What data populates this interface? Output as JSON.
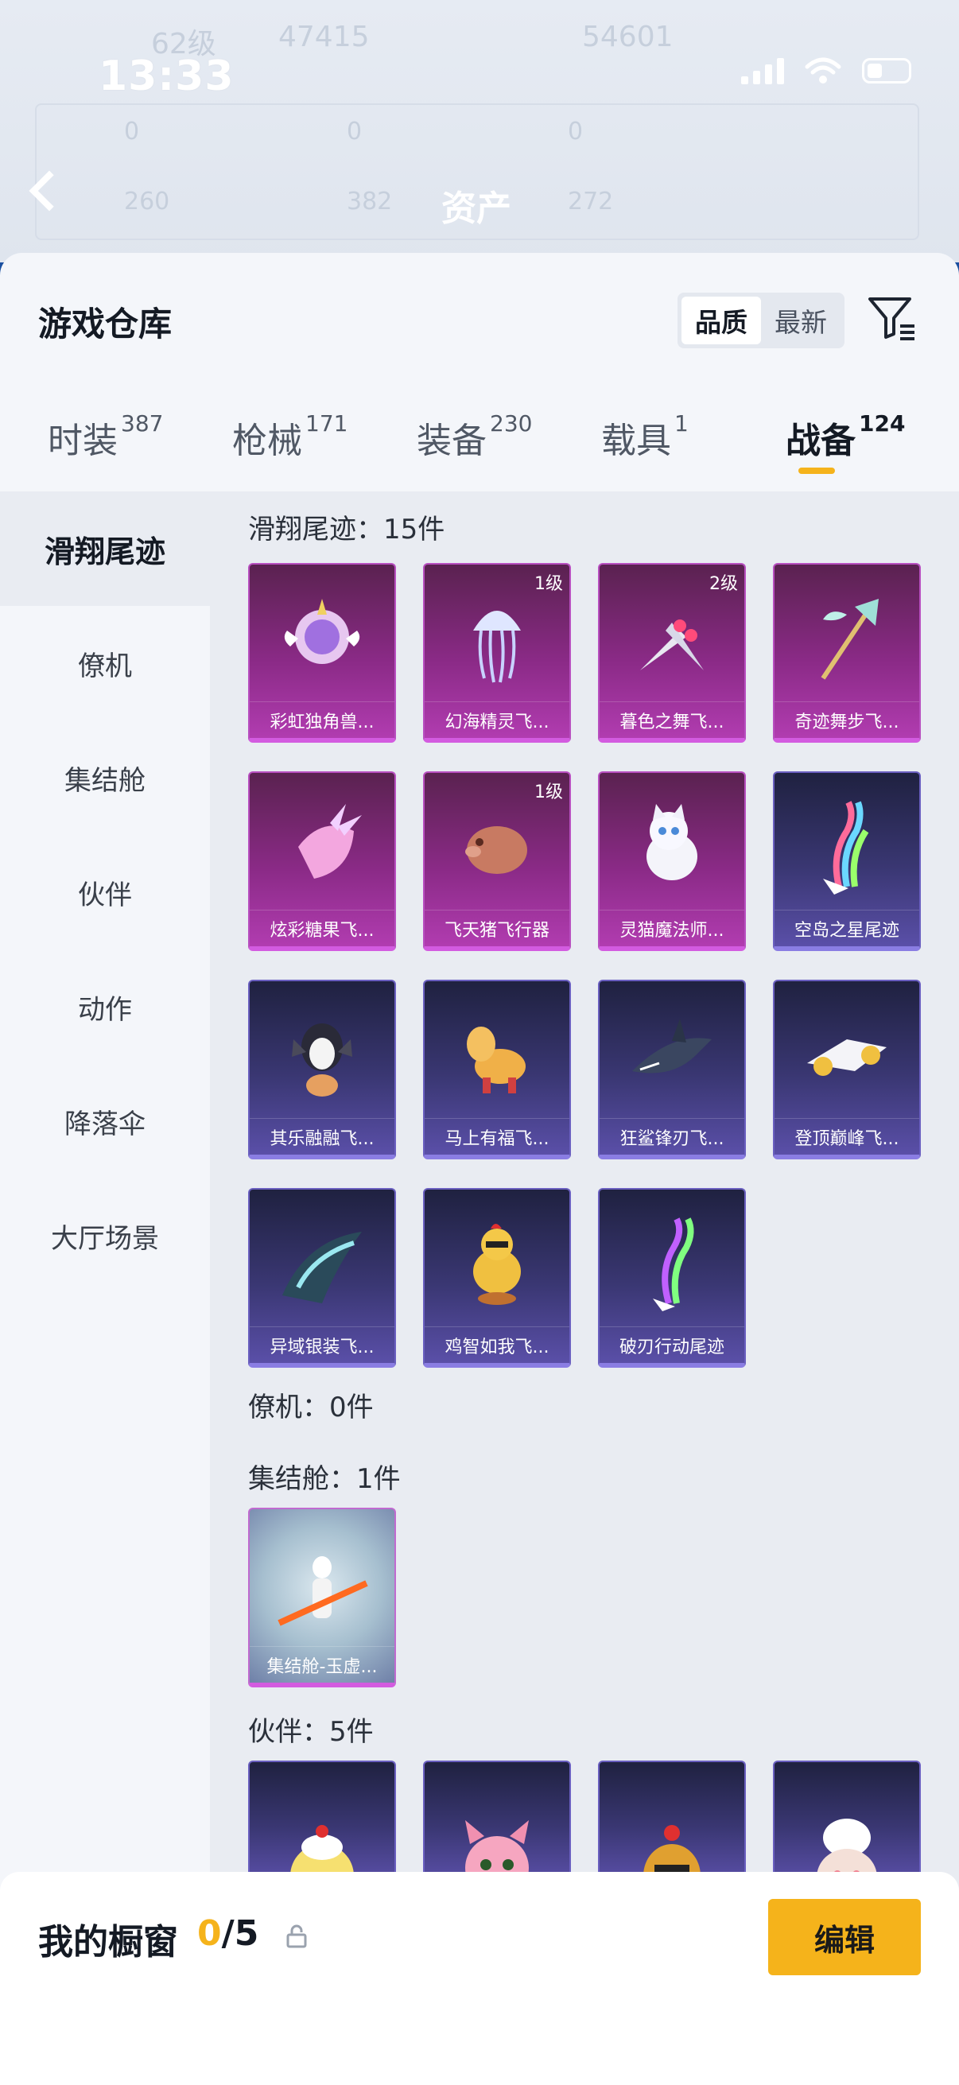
{
  "status_bar": {
    "time": "13:33"
  },
  "background": {
    "title": "资产",
    "faint_texts": [
      "62级",
      "47415",
      "54601",
      "0",
      "0",
      "0",
      "260",
      "382",
      "272"
    ]
  },
  "sheet": {
    "title": "游戏仓库",
    "sort": {
      "options": [
        "品质",
        "最新"
      ],
      "selected": "品质"
    },
    "filter_icon": "filter-icon",
    "tabs": [
      {
        "label": "时装",
        "count": "387"
      },
      {
        "label": "枪械",
        "count": "171"
      },
      {
        "label": "装备",
        "count": "230"
      },
      {
        "label": "载具",
        "count": "1"
      },
      {
        "label": "战备",
        "count": "124",
        "active": true
      }
    ],
    "sidebar": [
      {
        "label": "滑翔尾迹",
        "active": true
      },
      {
        "label": "僚机"
      },
      {
        "label": "集结舱"
      },
      {
        "label": "伙伴"
      },
      {
        "label": "动作"
      },
      {
        "label": "降落伞"
      },
      {
        "label": "大厅场景"
      }
    ],
    "sections": [
      {
        "label": "滑翔尾迹：15件"
      },
      {
        "label": "僚机：0件"
      },
      {
        "label": "集结舱：1件"
      },
      {
        "label": "伙伴：5件"
      }
    ],
    "items": [
      {
        "name": "彩虹独角兽...",
        "level": "",
        "rarity": "purple",
        "icon": "unicorn-badge-icon"
      },
      {
        "name": "幻海精灵飞...",
        "level": "1级",
        "rarity": "purple",
        "icon": "jellyfish-icon"
      },
      {
        "name": "暮色之舞飞...",
        "level": "2级",
        "rarity": "purple",
        "icon": "twin-blades-icon"
      },
      {
        "name": "奇迹舞步飞...",
        "level": "",
        "rarity": "purple",
        "icon": "trident-icon"
      },
      {
        "name": "炫彩糖果飞...",
        "level": "",
        "rarity": "purple",
        "icon": "candy-icon"
      },
      {
        "name": "飞天猪飞行器",
        "level": "1级",
        "rarity": "purple",
        "icon": "pig-icon"
      },
      {
        "name": "灵猫魔法师...",
        "level": "",
        "rarity": "purple",
        "icon": "cat-icon"
      },
      {
        "name": "空岛之星尾迹",
        "level": "",
        "rarity": "blue",
        "icon": "rainbow-trail-icon"
      },
      {
        "name": "其乐融融飞...",
        "level": "",
        "rarity": "blue",
        "icon": "penguin-icon"
      },
      {
        "name": "马上有福飞...",
        "level": "",
        "rarity": "blue",
        "icon": "horse-icon"
      },
      {
        "name": "狂鲨锋刃飞...",
        "level": "",
        "rarity": "blue",
        "icon": "shark-icon"
      },
      {
        "name": "登顶巅峰飞...",
        "level": "",
        "rarity": "blue",
        "icon": "jet-icon"
      },
      {
        "name": "异域银装飞...",
        "level": "",
        "rarity": "blue",
        "icon": "silver-wings-icon"
      },
      {
        "name": "鸡智如我飞...",
        "level": "",
        "rarity": "blue",
        "icon": "chicken-icon"
      },
      {
        "name": "破刃行动尾迹",
        "level": "",
        "rarity": "blue",
        "icon": "smoke-trail-icon"
      }
    ],
    "capsule_items": [
      {
        "name": "集结舱-玉虚...",
        "level": "",
        "rarity": "teal",
        "icon": "capsule-figure-icon"
      }
    ],
    "partner_items": [
      {
        "name": "",
        "icon": "chick-partner-icon"
      },
      {
        "name": "",
        "icon": "pink-creature-icon"
      },
      {
        "name": "",
        "icon": "chicken-partner-icon"
      },
      {
        "name": "",
        "icon": "chef-partner-icon"
      }
    ],
    "fab_icon": "share-icon"
  },
  "footer": {
    "label": "我的橱窗",
    "count_current": "0",
    "count_sep_total": "/5",
    "lock_icon": "lock-icon",
    "edit_label": "编辑"
  },
  "colors": {
    "accent": "#f5b31b",
    "purple_rarity": "#b13cb0",
    "blue_rarity": "#5a4fa8"
  }
}
